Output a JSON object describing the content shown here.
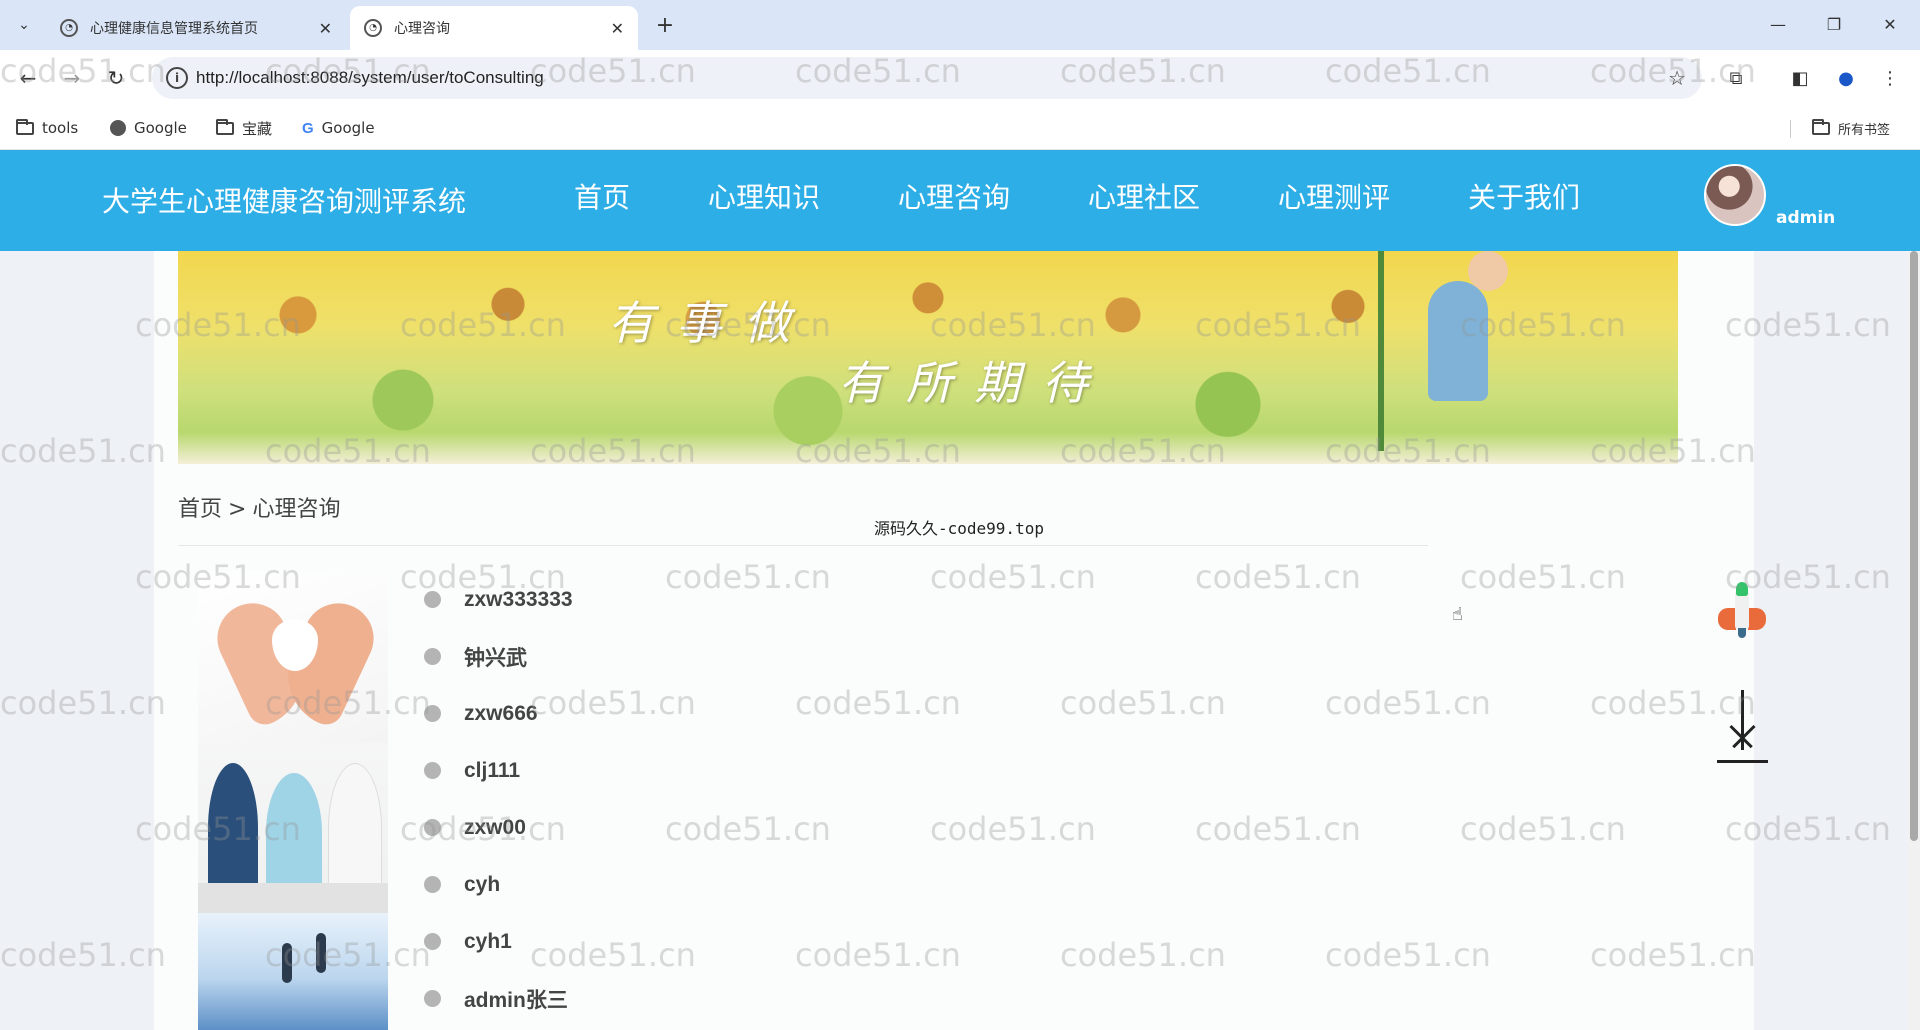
{
  "browser": {
    "tabs": [
      {
        "title": "心理健康信息管理系统首页",
        "active": false
      },
      {
        "title": "心理咨询",
        "active": true
      }
    ],
    "url": "http://localhost:8088/system/user/toConsulting",
    "bookmarks": [
      {
        "label": "tools",
        "icon": "folder-icon"
      },
      {
        "label": "Google",
        "icon": "globe-icon"
      },
      {
        "label": "宝藏",
        "icon": "folder-icon"
      },
      {
        "label": "Google",
        "icon": "google-icon"
      }
    ],
    "all_bookmarks_label": "所有书签"
  },
  "site": {
    "title": "大学生心理健康咨询测评系统",
    "nav": [
      "首页",
      "心理知识",
      "心理咨询",
      "心理社区",
      "心理测评",
      "关于我们"
    ],
    "user_name": "admin",
    "header_color": "#2eaee6"
  },
  "banner": {
    "lines": [
      "有事做",
      "有所期待"
    ]
  },
  "breadcrumb": {
    "home": "首页",
    "separator": ">",
    "current": "心理咨询"
  },
  "source_note": "源码久久-code99.top",
  "counselors": [
    "zxw333333",
    "钟兴武",
    "zxw666",
    "clj111",
    "zxw00",
    "cyh",
    "cyh1",
    "admin张三"
  ],
  "watermark_text": "code51.cn"
}
